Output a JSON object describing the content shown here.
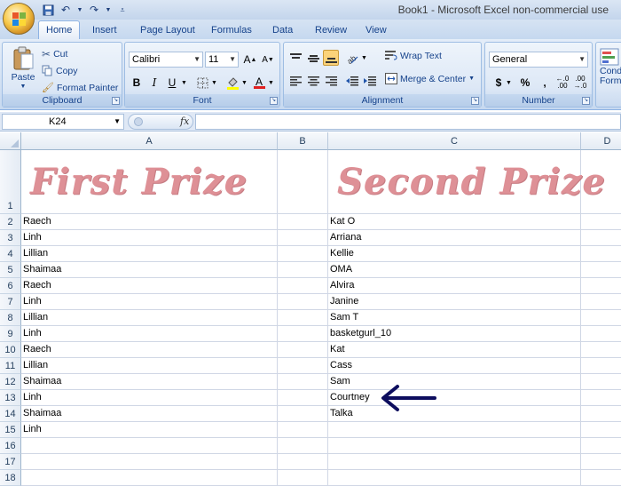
{
  "window": {
    "title": "Book1 - Microsoft Excel non-commercial use"
  },
  "tabs": [
    "Home",
    "Insert",
    "Page Layout",
    "Formulas",
    "Data",
    "Review",
    "View"
  ],
  "ribbon": {
    "clipboard": {
      "label": "Clipboard",
      "paste": "Paste",
      "cut": "Cut",
      "copy": "Copy",
      "format_painter": "Format Painter"
    },
    "font": {
      "label": "Font",
      "family": "Calibri",
      "size": "11",
      "bold": "B",
      "italic": "I",
      "underline": "U"
    },
    "alignment": {
      "label": "Alignment",
      "wrap_text": "Wrap Text",
      "merge_center": "Merge & Center"
    },
    "number": {
      "label": "Number",
      "format": "General",
      "currency": "$",
      "percent": "%",
      "comma": ","
    },
    "styles": {
      "conditional_formatting": "Cond Form"
    }
  },
  "formula_bar": {
    "name_box": "K24",
    "fx": "fx",
    "formula": ""
  },
  "columns": [
    "A",
    "B",
    "C",
    "D"
  ],
  "rows": [
    "1",
    "2",
    "3",
    "4",
    "5",
    "6",
    "7",
    "8",
    "9",
    "10",
    "11",
    "12",
    "13",
    "14",
    "15",
    "16",
    "17",
    "18"
  ],
  "headings": {
    "first": "First Prize",
    "second": "Second Prize"
  },
  "colA": [
    "Raech",
    "Linh",
    "Lillian",
    "Shaimaa",
    "Raech",
    "Linh",
    "Lillian",
    "Linh",
    "Raech",
    "Lillian",
    "Shaimaa",
    "Linh",
    "Shaimaa",
    "Linh"
  ],
  "colC": [
    "Kat O",
    "Arriana",
    "Kellie",
    "OMA",
    "Alvira",
    "Janine",
    "Sam T",
    "basketgurl_10",
    "Kat",
    "Cass",
    "Sam",
    "Courtney",
    "Talka"
  ],
  "colors": {
    "heading": "#de9096",
    "arrow": "#0d0d5e",
    "ribbon": "#dbe6f4"
  }
}
